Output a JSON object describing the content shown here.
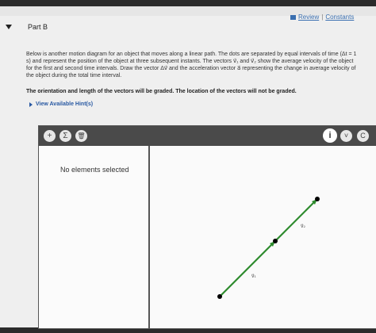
{
  "header": {
    "review_label": "Review",
    "separator": "|",
    "constants_label": "Constants"
  },
  "part": {
    "title": "Part B"
  },
  "prompt": {
    "description": "Below is another motion diagram for an object that moves along a linear path. The dots are separated by equal intervals of time (Δt = 1 s) and represent the position of the object at three subsequent instants. The vectors v⃗₁ and v⃗₂ show the average velocity of the object for the first and second time intervals. Draw the vector Δv⃗ and the acceleration vector a⃗ representing the change in average velocity of the object during the total time interval.",
    "grading_note": "The orientation and length of the vectors will be graded. The location of the vectors will not be graded.",
    "hint_link": "View Available Hint(s)"
  },
  "toolbar": {
    "add_symbol": "+",
    "sum_symbol": "Σ",
    "delete_symbol": "🗑",
    "info_symbol": "i",
    "chevron_symbol": "˅",
    "extra_symbol": "C"
  },
  "left_pane": {
    "status": "No elements selected"
  },
  "diagram": {
    "vector_labels": [
      "v⃗₁",
      "v⃗₂"
    ],
    "line_color": "#2e8b2e",
    "dot_color": "#000000"
  }
}
